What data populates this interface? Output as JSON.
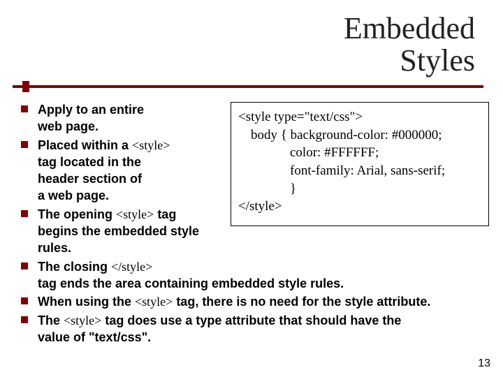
{
  "title_line1": "Embedded",
  "title_line2": "Styles",
  "bullets": {
    "b1a": "Apply to an entire",
    "b1b": "web page.",
    "b2a": "Placed within a ",
    "b2a_code": "<style>",
    "b2b": "tag located in the",
    "b2c": "header section of",
    "b2d": "a web page.",
    "b3a_pre": "The opening ",
    "b3a_code": "<style>",
    "b3a_post": " tag",
    "b3b": "begins the embedded style",
    "b3c": "rules.",
    "b4a_pre": "The closing ",
    "b4a_code": "</style>",
    "b4b": "tag ends the area containing embedded style rules.",
    "b5_pre": "When using the ",
    "b5_code": "<style>",
    "b5_post": " tag, there is no need for the style attribute.",
    "b6_pre": "The ",
    "b6_code": "<style>",
    "b6_post": " tag does use a type attribute that should have the",
    "b6b": "value of \"text/css\"."
  },
  "code": {
    "l1": "<style type=\"text/css\">",
    "l2": "body { background-color: #000000;",
    "l3": "color: #FFFFFF;",
    "l4": "font-family: Arial, sans-serif;",
    "l5": "}",
    "l6": "</style>"
  },
  "page_number": "13"
}
